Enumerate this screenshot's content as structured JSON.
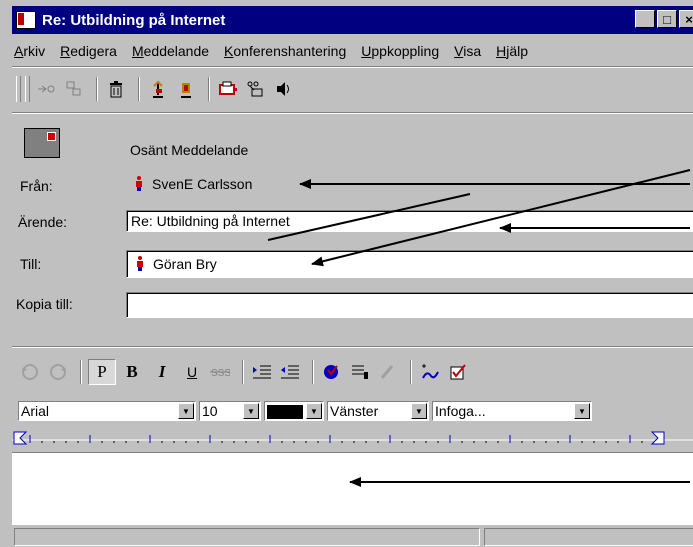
{
  "window": {
    "title": "Re: Utbildning på Internet",
    "buttons": [
      "_",
      "□",
      "×"
    ]
  },
  "menu": [
    {
      "label": "Arkiv",
      "accel": "A",
      "rest": "rkiv"
    },
    {
      "label": "Redigera",
      "accel": "R",
      "rest": "edigera"
    },
    {
      "label": "Meddelande",
      "accel": "M",
      "rest": "eddelande"
    },
    {
      "label": "Konferenshantering",
      "accel": "K",
      "rest": "onferenshantering"
    },
    {
      "label": "Uppkoppling",
      "accel": "U",
      "rest": "ppkoppling"
    },
    {
      "label": "Visa",
      "accel": "V",
      "rest": "isa"
    },
    {
      "label": "Hjälp",
      "accel": "H",
      "rest": "jälp"
    }
  ],
  "toolbar_icons": [
    "reply-icon",
    "forward-icon",
    "delete-icon",
    "previous-icon",
    "next-icon",
    "print-icon",
    "network-icon",
    "speaker-icon"
  ],
  "message": {
    "status": "Osänt Meddelande",
    "from_label": "Från:",
    "from_value": "SvenE Carlsson",
    "subject_label": "Ärende:",
    "subject_value": "Re: Utbildning på Internet",
    "to_label": "Till:",
    "to_value": "Göran Bry",
    "cc_label": "Kopia till:",
    "cc_value": ""
  },
  "format_toolbar": {
    "plain": "P",
    "bold": "B",
    "italic": "I",
    "underline": "U"
  },
  "format_combos": {
    "font": "Arial",
    "size": "10",
    "color": "#000000",
    "align": "Vänster",
    "insert": "Infoga..."
  },
  "editor": {
    "body": ""
  },
  "colors": {
    "titlebar": "#000080",
    "face": "#c0c0c0",
    "person_head": "#d00000",
    "person_body": "#0000c0"
  }
}
